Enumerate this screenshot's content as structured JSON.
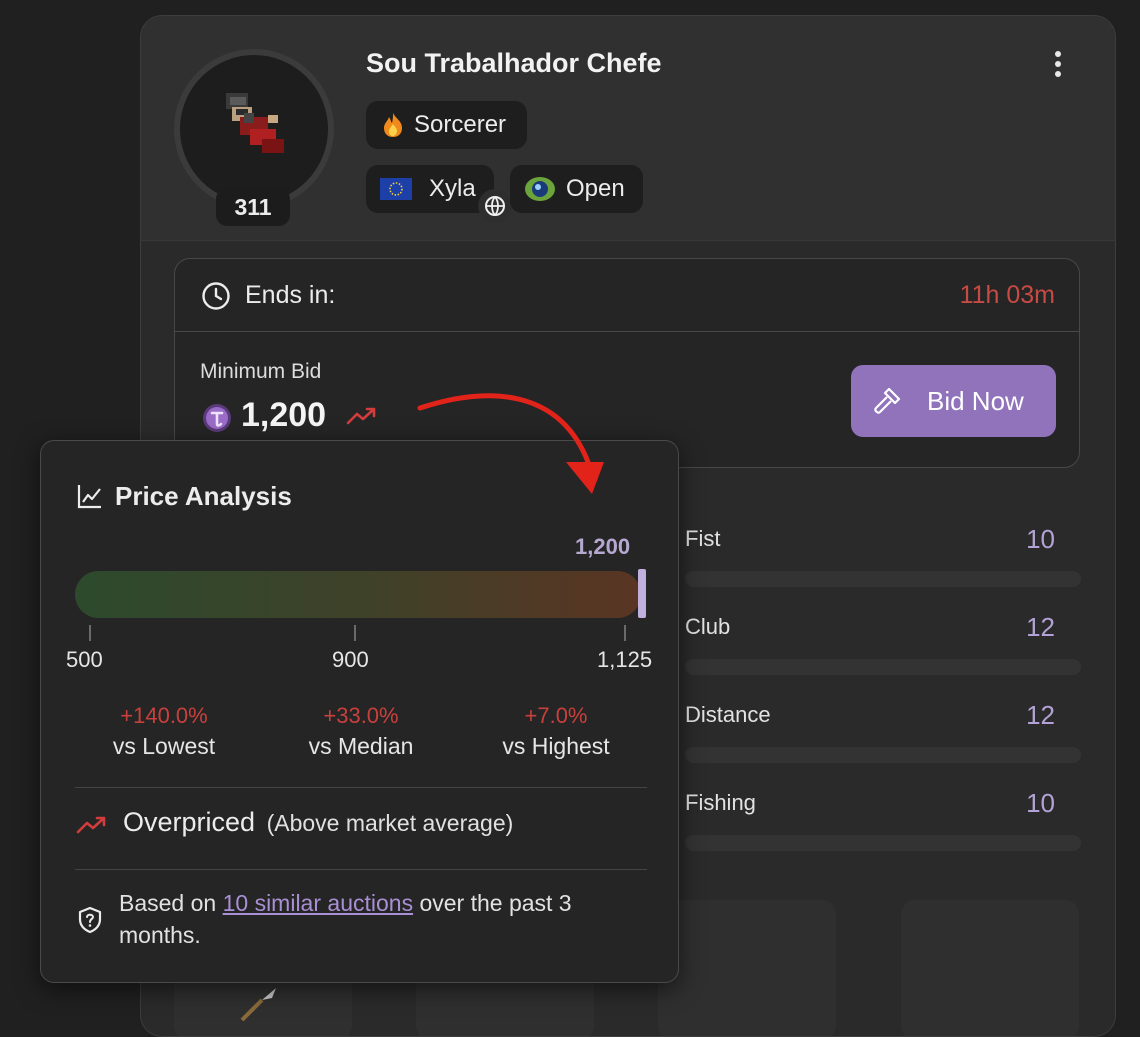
{
  "character": {
    "name": "Sou Trabalhador Chefe",
    "level": "311",
    "vocation": "Sorcerer",
    "world": "Xyla",
    "pvp_type": "Open"
  },
  "auction": {
    "ends_label": "Ends in:",
    "ends_time": "11h 03m",
    "min_bid_label": "Minimum Bid",
    "min_bid_value": "1,200",
    "bid_button": "Bid Now"
  },
  "skills": [
    {
      "name": "Fist",
      "value": "10"
    },
    {
      "name": "Club",
      "value": "12"
    },
    {
      "name": "Distance",
      "value": "12"
    },
    {
      "name": "Fishing",
      "value": "10"
    }
  ],
  "price_analysis": {
    "title": "Price Analysis",
    "current_value": "1,200",
    "scale_ticks": [
      "500",
      "900",
      "1,125"
    ],
    "comparisons": [
      {
        "pct": "+140.0%",
        "label": "vs Lowest"
      },
      {
        "pct": "+33.0%",
        "label": "vs Median"
      },
      {
        "pct": "+7.0%",
        "label": "vs Highest"
      }
    ],
    "verdict": "Overpriced",
    "verdict_detail": "(Above market average)",
    "note_prefix": "Based on ",
    "note_link": "10 similar auctions",
    "note_suffix": " over the past 3 months."
  },
  "colors": {
    "accent_purple": "#9073ba",
    "alert_red": "#c8403c",
    "ends_time_red": "#c84a44"
  },
  "icons": {
    "vocation": "fire-icon",
    "world": "eu-flag-icon",
    "pvp": "eye-orb-icon",
    "timer": "clock-icon",
    "coin": "tibia-coin-icon",
    "trend": "trending-up-icon",
    "bid": "gavel-icon",
    "analysis": "line-chart-icon",
    "note": "shield-question-icon"
  }
}
